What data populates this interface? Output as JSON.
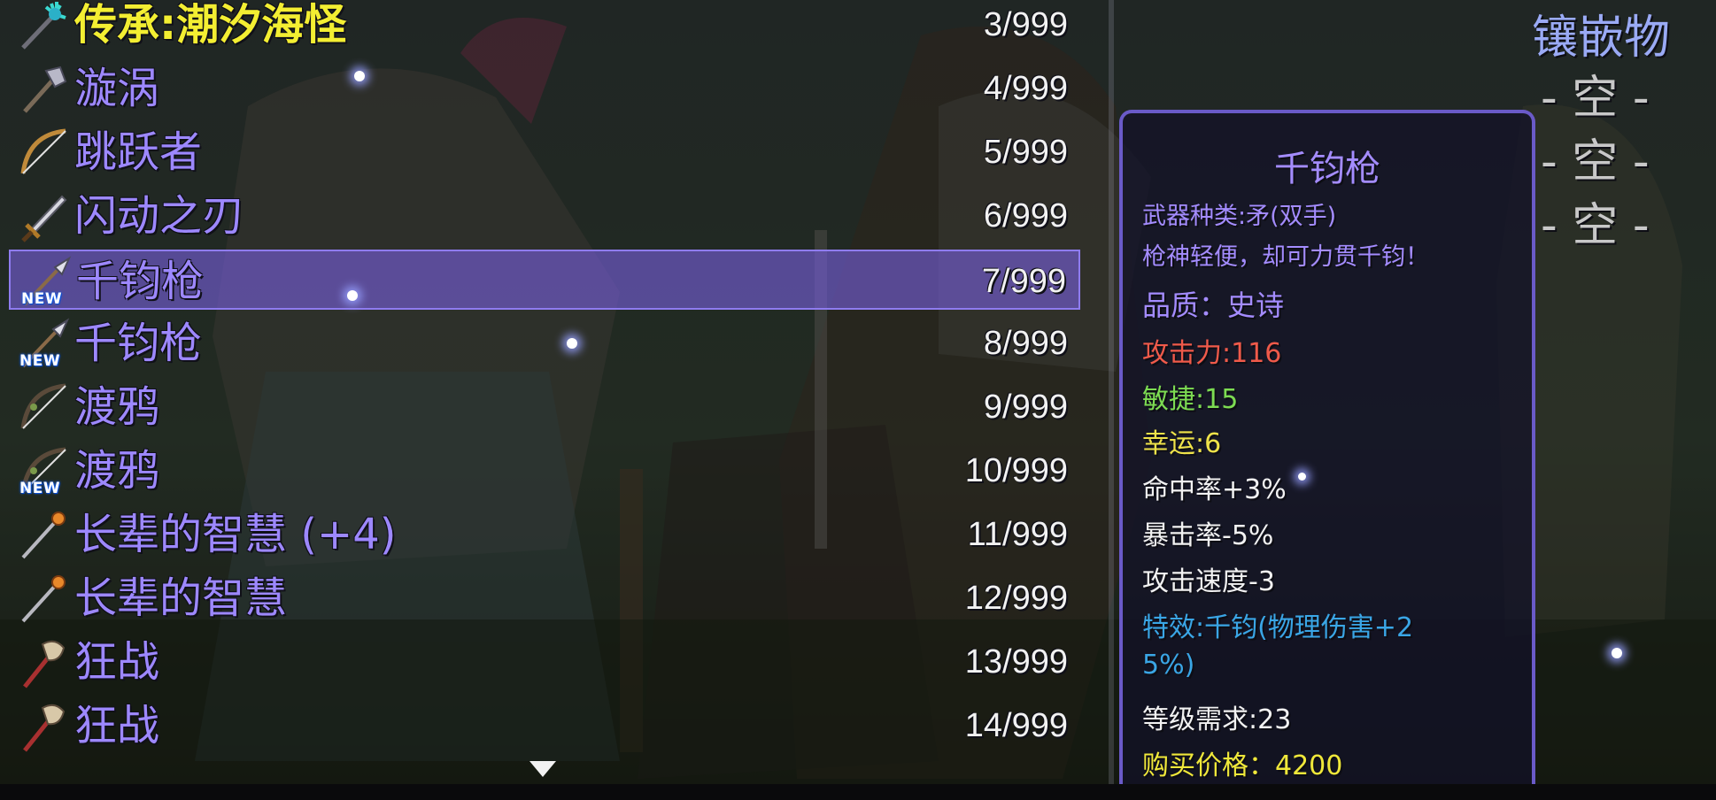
{
  "inventory": {
    "items": [
      {
        "name": "传承:潮汐海怪",
        "count": "3/999",
        "icon": "trident-icon",
        "rarity": "legendary"
      },
      {
        "name": "漩涡",
        "count": "4/999",
        "icon": "axe-icon"
      },
      {
        "name": "跳跃者",
        "count": "5/999",
        "icon": "bow-icon"
      },
      {
        "name": "闪动之刃",
        "count": "6/999",
        "icon": "sword-icon"
      },
      {
        "name": "千钧枪",
        "count": "7/999",
        "icon": "spear-icon",
        "badge": "NEW",
        "selected": true
      },
      {
        "name": "千钧枪",
        "count": "8/999",
        "icon": "spear-icon",
        "badge": "NEW"
      },
      {
        "name": "渡鸦",
        "count": "9/999",
        "icon": "bow-icon"
      },
      {
        "name": "渡鸦",
        "count": "10/999",
        "icon": "bow-icon",
        "badge": "NEW"
      },
      {
        "name": "长辈的智慧 (+4)",
        "count": "11/999",
        "icon": "staff-icon"
      },
      {
        "name": "长辈的智慧",
        "count": "12/999",
        "icon": "staff-icon"
      },
      {
        "name": "狂战",
        "count": "13/999",
        "icon": "battle-axe-icon"
      },
      {
        "name": "狂战",
        "count": "14/999",
        "icon": "battle-axe-icon"
      }
    ]
  },
  "detail": {
    "title": "千钧枪",
    "weapon_type": "武器种类:矛(双手)",
    "description": "枪神轻便，却可力贯千钧！",
    "quality": "品质：史诗",
    "attack": "攻击力:116",
    "agility": "敏捷:15",
    "luck": "幸运:6",
    "hit_rate": "命中率+3%",
    "crit_rate": "暴击率-5%",
    "attack_speed": "攻击速度-3",
    "effect_line1": "特效:千钧(物理伤害+2",
    "effect_line2": "5%)",
    "level_req": "等级需求:23",
    "buy_price": "购买价格：4200"
  },
  "gems": {
    "title": "镶嵌物",
    "slots": [
      "- 空 -",
      "- 空 -",
      "- 空 -"
    ]
  },
  "colors": {
    "item_name": "#9d88ff",
    "legendary": "#f3ee32",
    "attack": "#f05a4a",
    "agility": "#7ddc52",
    "luck": "#efe34a",
    "effect": "#3aa6e6",
    "price": "#f0e83a"
  }
}
